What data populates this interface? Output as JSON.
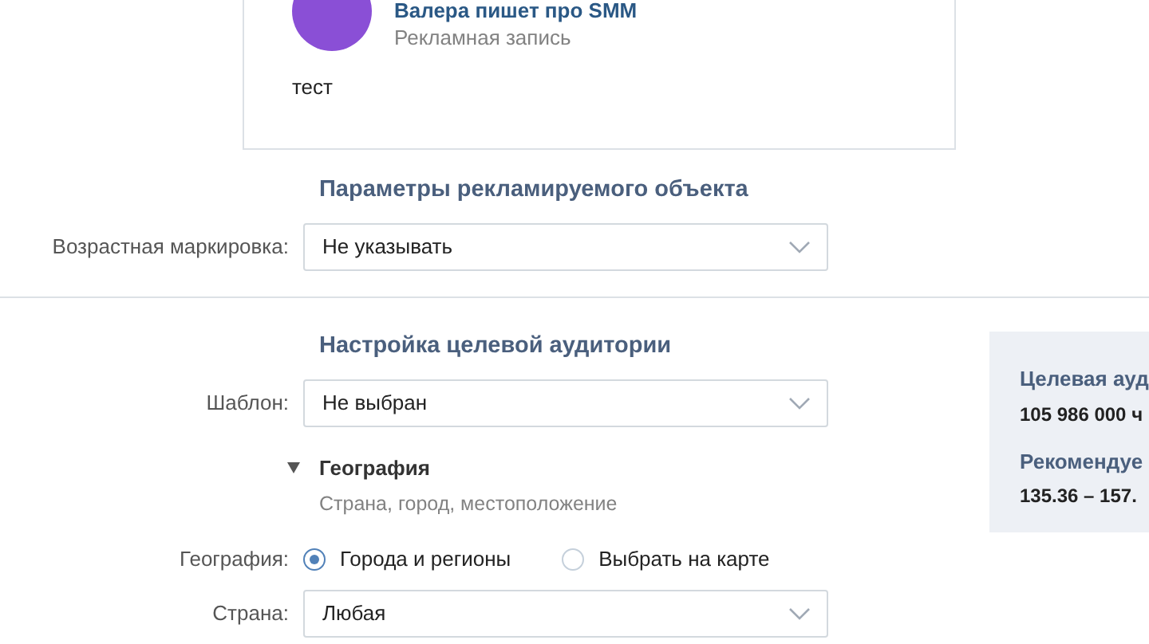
{
  "post": {
    "author": "Валера пишет про SMM",
    "subtitle": "Рекламная запись",
    "text": "тест"
  },
  "object_params": {
    "title": "Параметры рекламируемого объекта",
    "rows": [
      {
        "kind": "select",
        "label": "Возрастная маркировка:",
        "value": "Не указывать"
      }
    ]
  },
  "audience": {
    "title": "Настройка целевой аудитории",
    "rows": [
      {
        "kind": "select",
        "label": "Шаблон:",
        "value": "Не выбран"
      },
      {
        "kind": "group",
        "title": "География",
        "expanded": true,
        "hint": "Страна, город, местоположение"
      },
      {
        "kind": "radio",
        "label": "География:",
        "options": [
          {
            "label": "Города и регионы",
            "selected": true
          },
          {
            "label": "Выбрать на карте",
            "selected": false
          }
        ]
      },
      {
        "kind": "select",
        "label": "Страна:",
        "value": "Любая"
      }
    ]
  },
  "summary": [
    {
      "title": "Целевая ауд",
      "value": "105 986 000 ч"
    },
    {
      "title": "Рекомендуе",
      "value": "135.36 – 157."
    }
  ]
}
